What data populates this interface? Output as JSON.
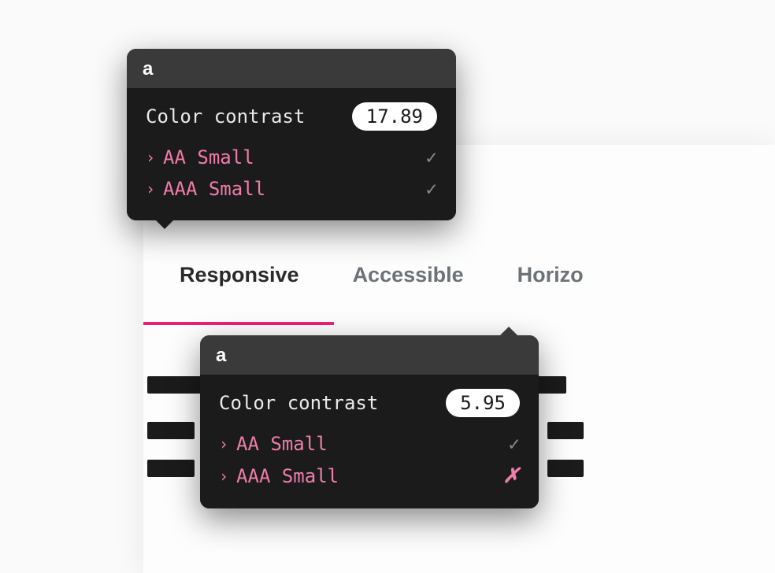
{
  "card": {
    "tabs": [
      {
        "label": "Responsive",
        "active": true
      },
      {
        "label": "Accessible",
        "active": false
      },
      {
        "label": "Horizo",
        "active": false
      }
    ]
  },
  "tooltip1": {
    "header": "a",
    "title": "Color contrast",
    "value": "17.89",
    "checks": [
      {
        "label": "AA Small",
        "pass": true
      },
      {
        "label": "AAA Small",
        "pass": true
      }
    ]
  },
  "tooltip2": {
    "header": "a",
    "title": "Color contrast",
    "value": "5.95",
    "checks": [
      {
        "label": "AA Small",
        "pass": true
      },
      {
        "label": "AAA Small",
        "pass": false
      }
    ]
  },
  "icons": {
    "chevron": "›",
    "check": "✓",
    "fail": "✗"
  }
}
